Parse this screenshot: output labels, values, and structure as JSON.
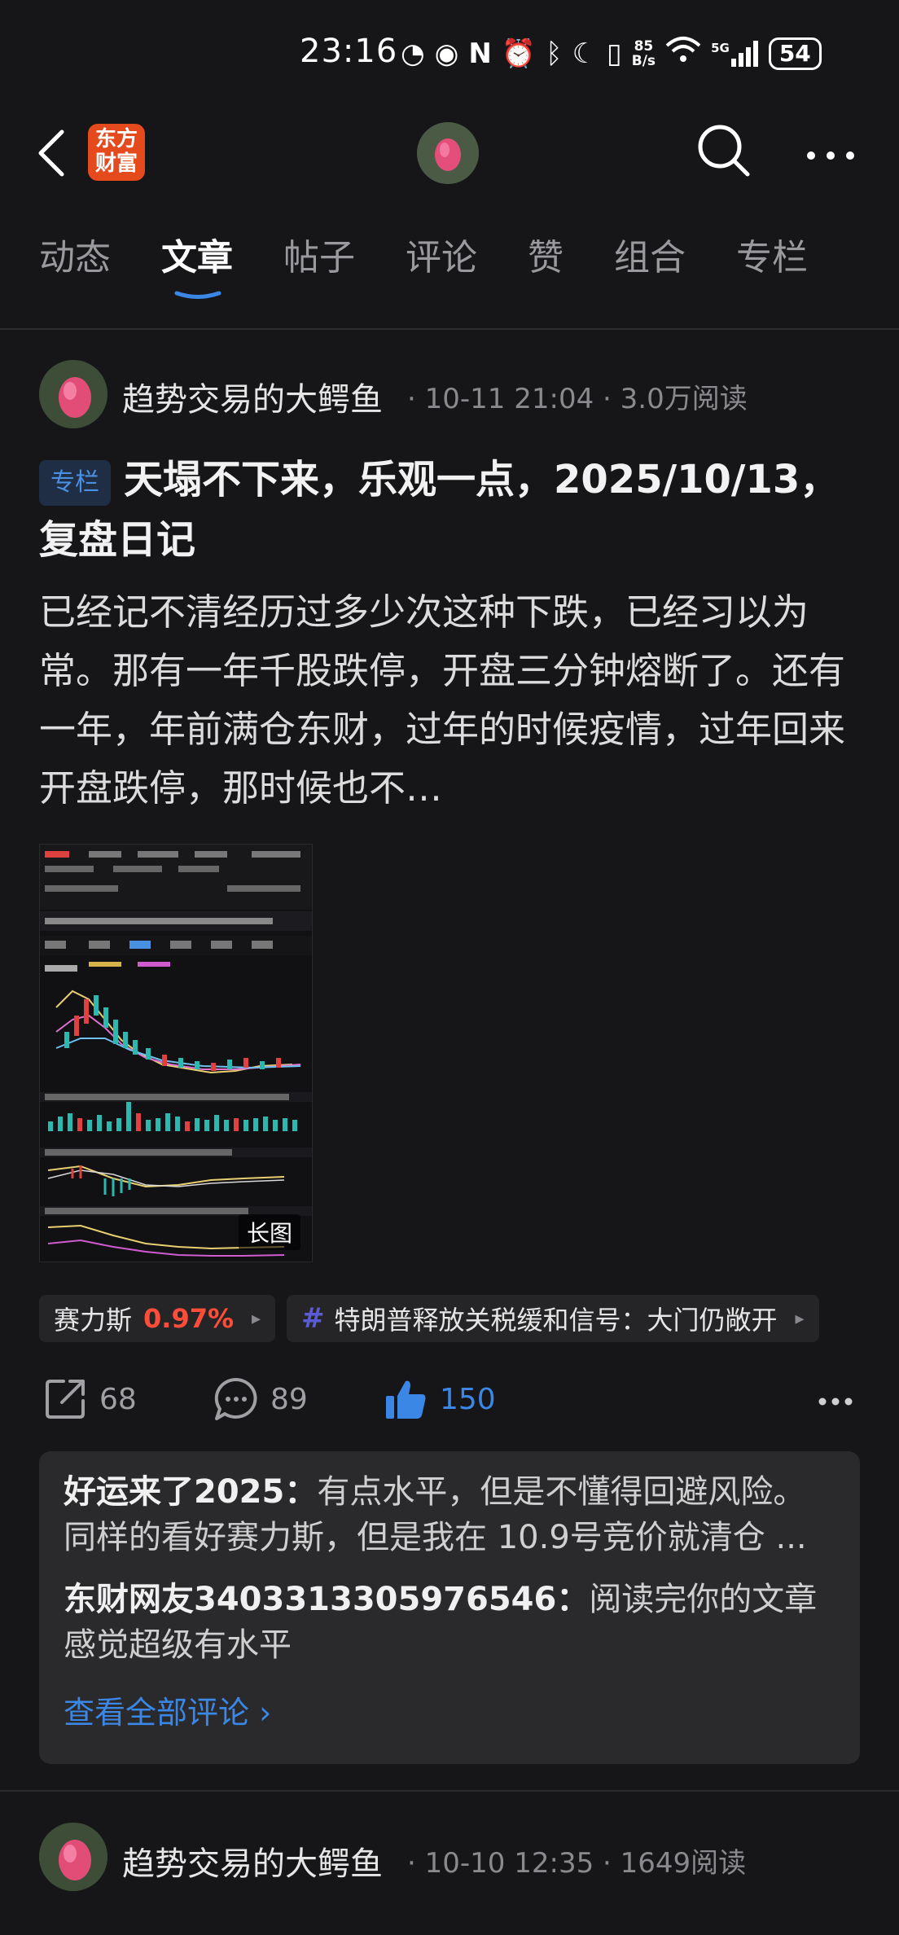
{
  "status_bar": {
    "time": "23:16",
    "net_speed_top": "85",
    "net_speed_bottom": "B/s",
    "signal_label": "5G",
    "battery": "54"
  },
  "header": {
    "logo_line1": "东方",
    "logo_line2": "财富"
  },
  "tabs": [
    {
      "label": "动态"
    },
    {
      "label": "文章"
    },
    {
      "label": "帖子"
    },
    {
      "label": "评论"
    },
    {
      "label": "赞"
    },
    {
      "label": "组合"
    },
    {
      "label": "专栏"
    }
  ],
  "active_tab": "文章",
  "post1": {
    "author": "趋势交易的大鳄鱼",
    "meta": "· 10-11 21:04 · 3.0万阅读",
    "badge": "专栏",
    "title": "天塌不下来，乐观一点，2025/10/13，复盘日记",
    "body": "已经记不清经历过多少次这种下跌，已经习以为常。那有一年千股跌停，开盘三分钟熔断了。还有一年，年前满仓东财，过年的时候疫情，过年回来开盘跌停，那时候也不…",
    "image_tag": "长图",
    "stock_chip": {
      "name": "赛力斯",
      "change": "0.97%",
      "arrow": "▸"
    },
    "topic_chip": {
      "hash": "#",
      "text": "特朗普释放关税缓和信号：大门仍敞开",
      "arrow": "▸"
    },
    "actions": {
      "share": "68",
      "comment": "89",
      "like": "150"
    },
    "comments": [
      {
        "user": "好运来了2025",
        "sep": "：",
        "text": "有点水平，但是不懂得回避风险。同样的看好赛力斯，但是我在 10.9号竞价就清仓 ..."
      },
      {
        "user": "东财网友3403313305976546",
        "sep": "：",
        "text": "阅读完你的文章感觉超级有水平"
      }
    ],
    "view_all": "查看全部评论 ›"
  },
  "post2": {
    "author": "趋势交易的大鳄鱼",
    "meta": "· 10-10 12:35 · 1649阅读"
  },
  "colors": {
    "bg": "#161618",
    "accent": "#3b87e6",
    "up_red": "#ff4d3a",
    "logo": "#e54a1d"
  }
}
